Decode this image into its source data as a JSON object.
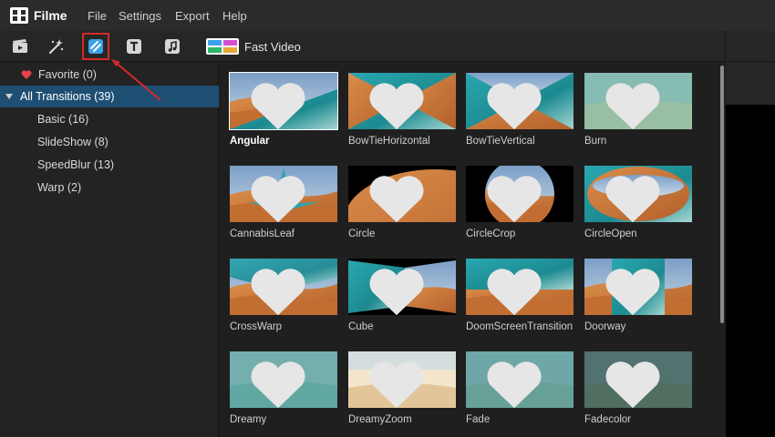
{
  "app": {
    "name": "Filme"
  },
  "menu": [
    "File",
    "Settings",
    "Export",
    "Help"
  ],
  "toolbar": {
    "tools": [
      {
        "name": "media-icon"
      },
      {
        "name": "effects-icon"
      },
      {
        "name": "transitions-icon"
      },
      {
        "name": "text-icon"
      },
      {
        "name": "music-icon"
      }
    ],
    "fast_video_label": "Fast Video"
  },
  "sidebar": {
    "favorite": "Favorite (0)",
    "all": "All Transitions (39)",
    "categories": [
      "Basic (16)",
      "SlideShow (8)",
      "SpeedBlur (13)",
      "Warp (2)"
    ]
  },
  "transitions": [
    "Angular",
    "BowTieHorizontal",
    "BowTieVertical",
    "Burn",
    "CannabisLeaf",
    "Circle",
    "CircleCrop",
    "CircleOpen",
    "CrossWarp",
    "Cube",
    "DoomScreenTransition",
    "Doorway",
    "Dreamy",
    "DreamyZoom",
    "Fade",
    "Fadecolor"
  ],
  "colors": {
    "accent_selected": "#1f4e73",
    "highlight_box": "#d42a2a",
    "heart": "#e8414e"
  }
}
